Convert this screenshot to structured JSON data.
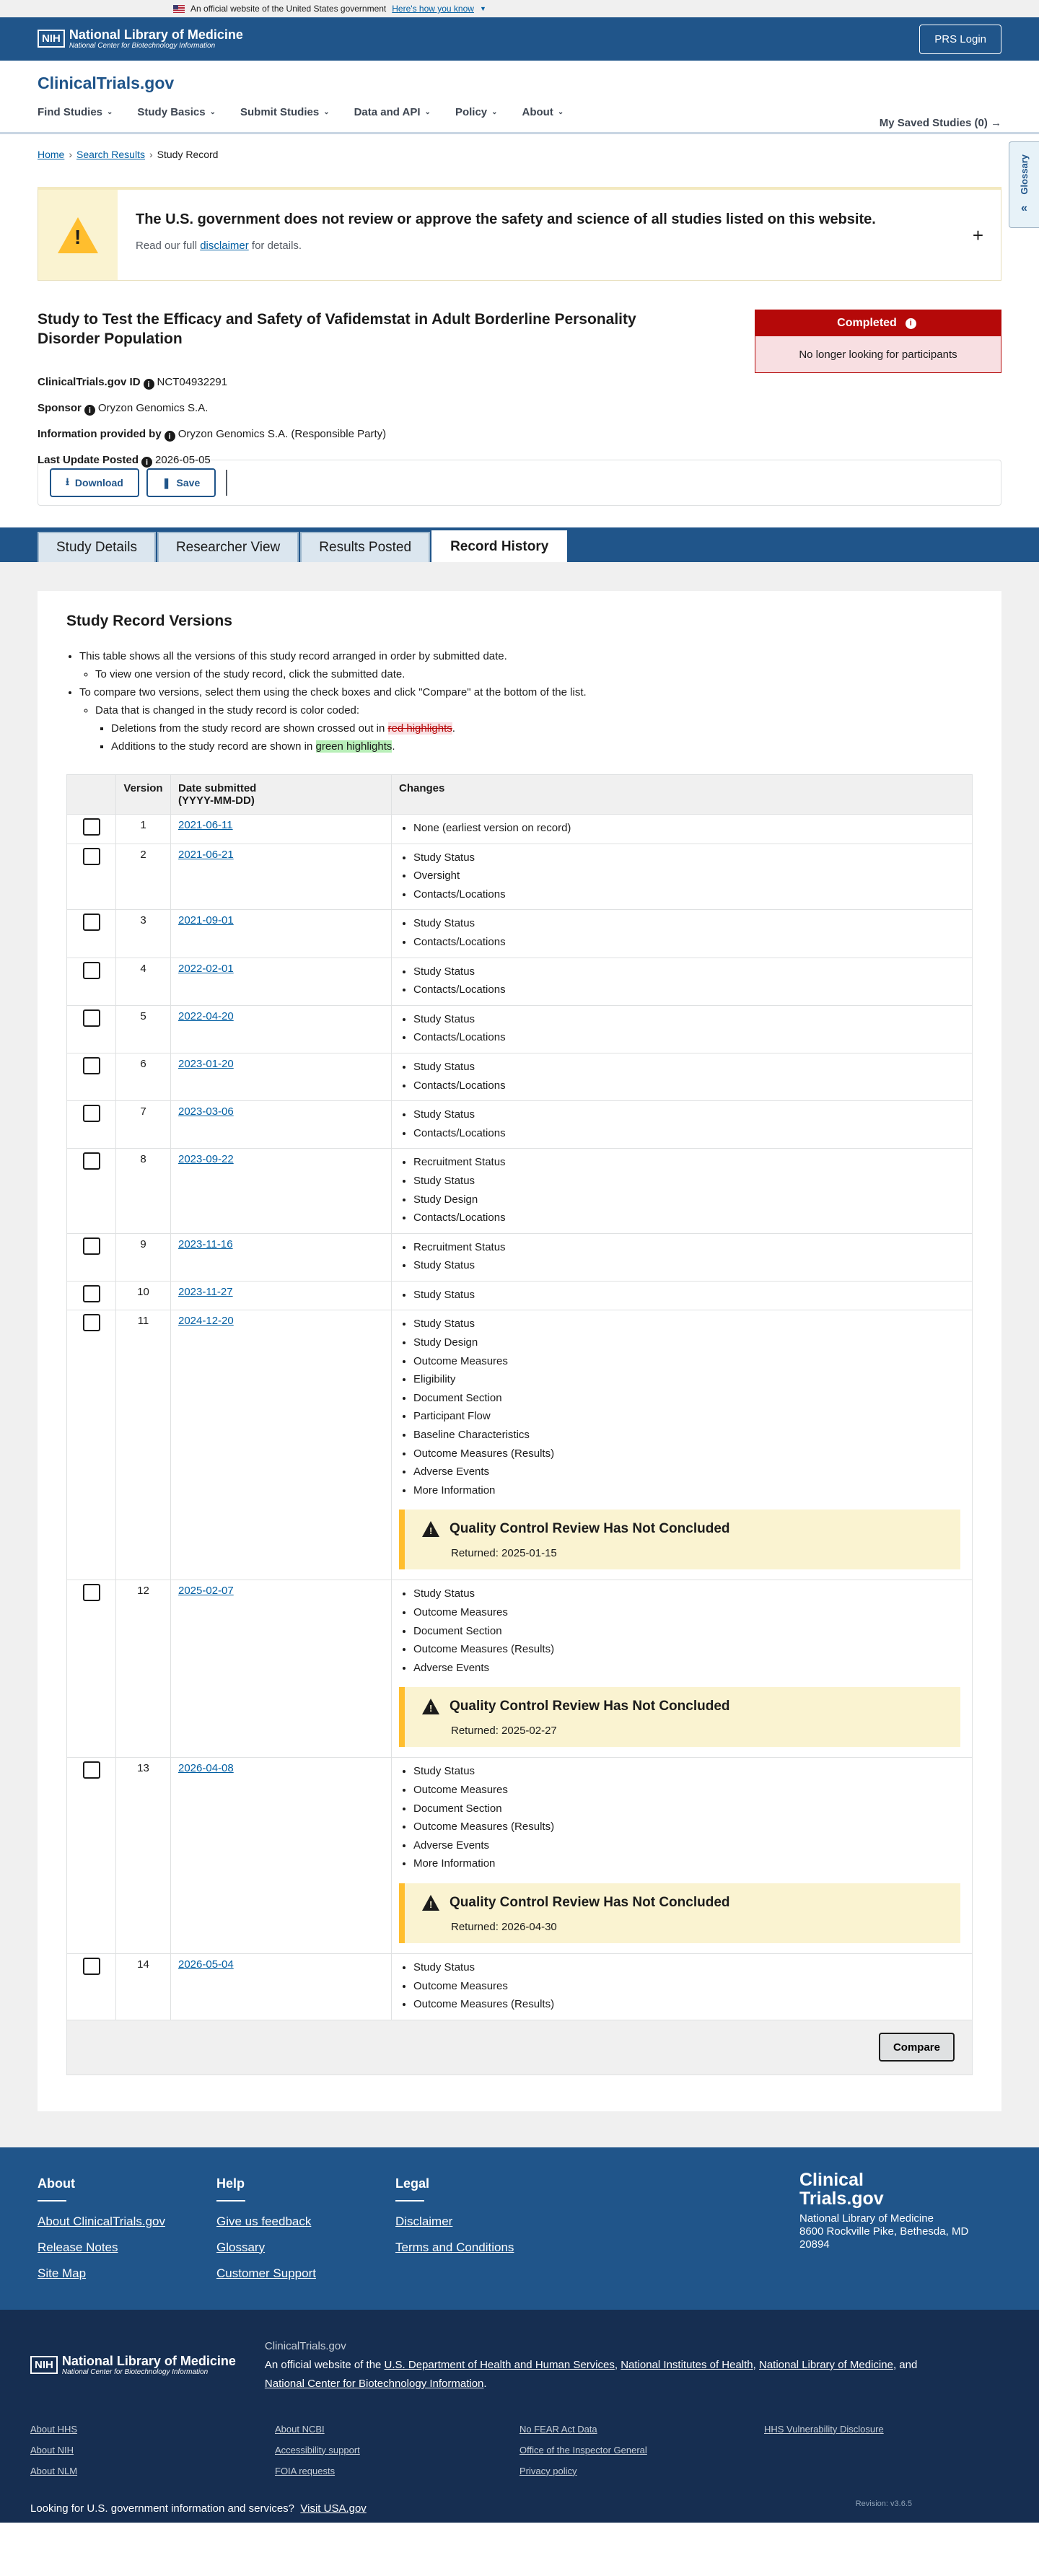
{
  "gov_banner": {
    "text": "An official website of the United States government",
    "link": "Here's how you know"
  },
  "nlm": {
    "nih": "NIH",
    "title": "National Library of Medicine",
    "subtitle": "National Center for Biotechnology Information",
    "prs_login": "PRS Login"
  },
  "header": {
    "logo": "ClinicalTrials.gov",
    "nav": [
      "Find Studies",
      "Study Basics",
      "Submit Studies",
      "Data and API",
      "Policy",
      "About"
    ],
    "saved": "My Saved Studies (0) →"
  },
  "breadcrumb": {
    "home": "Home",
    "results": "Search Results",
    "current": "Study Record"
  },
  "glossary": "Glossary",
  "alert": {
    "title": "The U.S. government does not review or approve the safety and science of all studies listed on this website.",
    "pre": "Read our full ",
    "link": "disclaimer",
    "post": " for details."
  },
  "study": {
    "title": "Study to Test the Efficacy and Safety of Vafidemstat in Adult Borderline Personality Disorder Population",
    "id_label": "ClinicalTrials.gov ID",
    "id": "NCT04932291",
    "sponsor_label": "Sponsor",
    "sponsor": "Oryzon Genomics S.A.",
    "provided_label": "Information provided by",
    "provided": "Oryzon Genomics S.A. (Responsible Party)",
    "updated_label": "Last Update Posted",
    "updated": "2026-05-05",
    "status": "Completed",
    "status_note": "No longer looking for participants"
  },
  "actions": {
    "download": "Download",
    "save": "Save"
  },
  "tabs": [
    "Study Details",
    "Researcher View",
    "Results Posted",
    "Record History"
  ],
  "record": {
    "heading": "Study Record Versions",
    "intro1": "This table shows all the versions of this study record arranged in order by submitted date.",
    "intro2": "To view one version of the study record, click the submitted date.",
    "intro3": "To compare two versions, select them using the check boxes and click \"Compare\" at the bottom of the list.",
    "intro4": "Data that is changed in the study record is color coded:",
    "del_pre": "Deletions from the study record are shown crossed out in ",
    "del_word": "red highlights",
    "del_post": ".",
    "add_pre": "Additions to the study record are shown in ",
    "add_word": "green highlights",
    "add_post": ".",
    "col_version": "Version",
    "col_date": "Date submitted (YYYY-MM-DD)",
    "col_changes": "Changes",
    "compare": "Compare",
    "qc_title": "Quality Control Review Has Not Concluded"
  },
  "versions": [
    {
      "v": "1",
      "date": "2021-06-11",
      "changes": [
        "None (earliest version on record)"
      ]
    },
    {
      "v": "2",
      "date": "2021-06-21",
      "changes": [
        "Study Status",
        "Oversight",
        "Contacts/Locations"
      ]
    },
    {
      "v": "3",
      "date": "2021-09-01",
      "changes": [
        "Study Status",
        "Contacts/Locations"
      ]
    },
    {
      "v": "4",
      "date": "2022-02-01",
      "changes": [
        "Study Status",
        "Contacts/Locations"
      ]
    },
    {
      "v": "5",
      "date": "2022-04-20",
      "changes": [
        "Study Status",
        "Contacts/Locations"
      ]
    },
    {
      "v": "6",
      "date": "2023-01-20",
      "changes": [
        "Study Status",
        "Contacts/Locations"
      ]
    },
    {
      "v": "7",
      "date": "2023-03-06",
      "changes": [
        "Study Status",
        "Contacts/Locations"
      ]
    },
    {
      "v": "8",
      "date": "2023-09-22",
      "changes": [
        "Recruitment Status",
        "Study Status",
        "Study Design",
        "Contacts/Locations"
      ]
    },
    {
      "v": "9",
      "date": "2023-11-16",
      "changes": [
        "Recruitment Status",
        "Study Status"
      ]
    },
    {
      "v": "10",
      "date": "2023-11-27",
      "changes": [
        "Study Status"
      ]
    },
    {
      "v": "11",
      "date": "2024-12-20",
      "changes": [
        "Study Status",
        "Study Design",
        "Outcome Measures",
        "Eligibility",
        "Document Section",
        "Participant Flow",
        "Baseline Characteristics",
        "Outcome Measures (Results)",
        "Adverse Events",
        "More Information"
      ],
      "qc": "Returned: 2025-01-15"
    },
    {
      "v": "12",
      "date": "2025-02-07",
      "changes": [
        "Study Status",
        "Outcome Measures",
        "Document Section",
        "Outcome Measures (Results)",
        "Adverse Events"
      ],
      "qc": "Returned: 2025-02-27"
    },
    {
      "v": "13",
      "date": "2026-04-08",
      "changes": [
        "Study Status",
        "Outcome Measures",
        "Document Section",
        "Outcome Measures (Results)",
        "Adverse Events",
        "More Information"
      ],
      "qc": "Returned: 2026-04-30"
    },
    {
      "v": "14",
      "date": "2026-05-04",
      "changes": [
        "Study Status",
        "Outcome Measures",
        "Outcome Measures (Results)"
      ]
    }
  ],
  "footer": {
    "about_h": "About",
    "about": [
      "About ClinicalTrials.gov",
      "Release Notes",
      "Site Map"
    ],
    "help_h": "Help",
    "help": [
      "Give us feedback",
      "Glossary",
      "Customer Support"
    ],
    "legal_h": "Legal",
    "legal": [
      "Disclaimer",
      "Terms and Conditions"
    ],
    "brand1": "Clinical",
    "brand2": "Trials.gov",
    "org": "National Library of Medicine",
    "addr": "8600 Rockville Pike, Bethesda, MD 20894",
    "site": "ClinicalTrials.gov",
    "off_pre": "An official website of the ",
    "hhs": "U.S. Department of Health and Human Services",
    "nih": "National Institutes of Health",
    "nlm": "National Library of Medicine",
    "and": "and",
    "ncbi": "National Center for Biotechnology Information",
    "links": [
      [
        "About HHS",
        "About NIH",
        "About NLM"
      ],
      [
        "About NCBI",
        "Accessibility support",
        "FOIA requests"
      ],
      [
        "No FEAR Act Data",
        "Office of the Inspector General",
        "Privacy policy"
      ],
      [
        "HHS Vulnerability Disclosure"
      ]
    ],
    "usa_pre": "Looking for U.S. government information and services?",
    "usa": "Visit USA.gov",
    "revision": "Revision: v3.6.5"
  }
}
